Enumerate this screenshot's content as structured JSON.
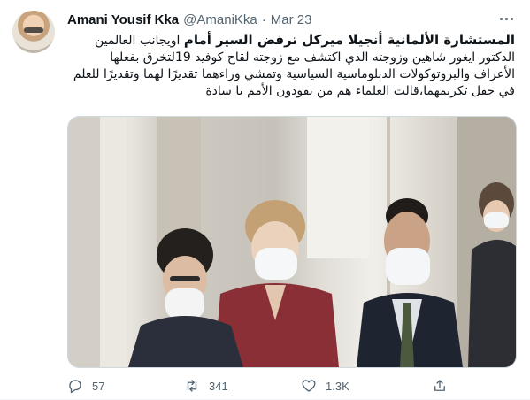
{
  "tweet": {
    "author_name": "Amani Yousif Kka",
    "handle": "@AmaniKka",
    "separator": "·",
    "date": "Mar 23",
    "text_bold": "المستشارة الألمانية أنجيلا ميركل ترفض السير أمام",
    "text_rest": " اويجانب العالمين الدكتور ايغور شاهين وزوجته الذي اكتشف مع زوجته لقاح كوفيد 19لتخرق بفعلها الأعراف والبروتوكولات الدبلوماسية السياسية وتمشي وراءهما تقديرًا لهما وتقديرًا للعلم في حفل تكريمهما،قالت العلماء هم من يقودون الأمم يا سادة",
    "actions": {
      "replies": "57",
      "retweets": "341",
      "likes": "1.3K"
    }
  },
  "colors": {
    "text": "#0f1419",
    "secondary": "#536471",
    "border": "#cfd9de"
  },
  "icons": [
    "more-icon",
    "reply-icon",
    "retweet-icon",
    "like-icon",
    "share-icon"
  ]
}
